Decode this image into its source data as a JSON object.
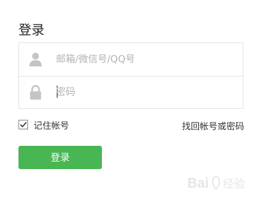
{
  "login": {
    "title": "登录",
    "account_placeholder": "邮箱/微信号/QQ号",
    "password_placeholder": "密码",
    "remember_label": "记住帐号",
    "remember_checked": true,
    "forgot_link": "找回帐号或密码",
    "submit_label": "登录"
  },
  "icons": {
    "account": "user-icon",
    "password": "lock-icon",
    "checkbox": "checkmark-icon"
  },
  "colors": {
    "button": "#48b653",
    "border": "#e3e3e3",
    "placeholder": "#b3b3b3",
    "icon": "#c4c4c4"
  }
}
